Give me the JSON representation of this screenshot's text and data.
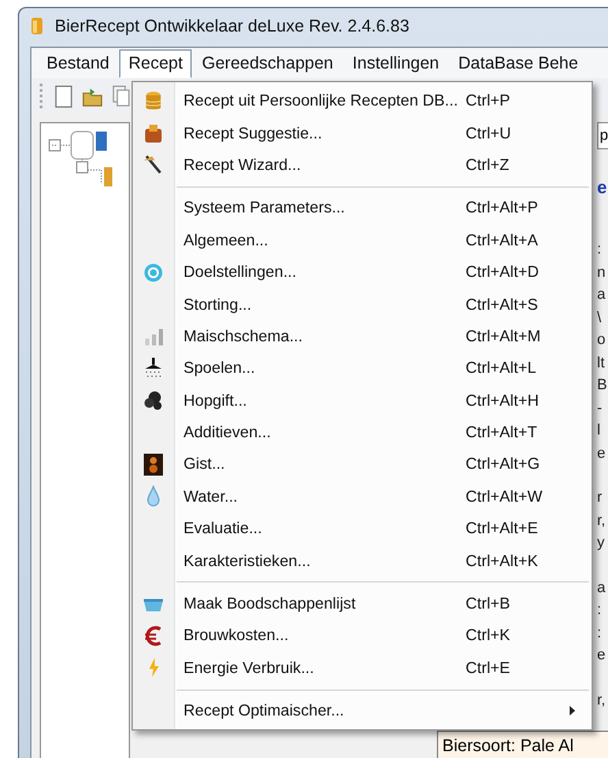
{
  "window": {
    "title": "BierRecept Ontwikkelaar deLuxe Rev. 2.4.6.83"
  },
  "menubar": [
    {
      "label": "Bestand",
      "selected": false
    },
    {
      "label": "Recept",
      "selected": true
    },
    {
      "label": "Gereedschappen",
      "selected": false
    },
    {
      "label": "Instellingen",
      "selected": false
    },
    {
      "label": "DataBase Behe",
      "selected": false
    }
  ],
  "menu": [
    {
      "kind": "item",
      "label": "Recept uit Persoonlijke Recepten DB...",
      "shortcut": "Ctrl+P"
    },
    {
      "kind": "item",
      "label": "Recept Suggestie...",
      "shortcut": "Ctrl+U"
    },
    {
      "kind": "item",
      "label": "Recept Wizard...",
      "shortcut": "Ctrl+Z"
    },
    {
      "kind": "separator"
    },
    {
      "kind": "item",
      "label": "Systeem Parameters...",
      "shortcut": "Ctrl+Alt+P"
    },
    {
      "kind": "item",
      "label": "Algemeen...",
      "shortcut": "Ctrl+Alt+A"
    },
    {
      "kind": "item",
      "label": "Doelstellingen...",
      "shortcut": "Ctrl+Alt+D"
    },
    {
      "kind": "item",
      "label": "Storting...",
      "shortcut": "Ctrl+Alt+S"
    },
    {
      "kind": "item",
      "label": "Maischschema...",
      "shortcut": "Ctrl+Alt+M"
    },
    {
      "kind": "item",
      "label": "Spoelen...",
      "shortcut": "Ctrl+Alt+L"
    },
    {
      "kind": "item",
      "label": "Hopgift...",
      "shortcut": "Ctrl+Alt+H"
    },
    {
      "kind": "item",
      "label": "Additieven...",
      "shortcut": "Ctrl+Alt+T"
    },
    {
      "kind": "item",
      "label": "Gist...",
      "shortcut": "Ctrl+Alt+G"
    },
    {
      "kind": "item",
      "label": "Water...",
      "shortcut": "Ctrl+Alt+W"
    },
    {
      "kind": "item",
      "label": "Evaluatie...",
      "shortcut": "Ctrl+Alt+E"
    },
    {
      "kind": "item",
      "label": "Karakteristieken...",
      "shortcut": "Ctrl+Alt+K"
    },
    {
      "kind": "separator"
    },
    {
      "kind": "item",
      "label": "Maak Boodschappenlijst",
      "shortcut": "Ctrl+B"
    },
    {
      "kind": "item",
      "label": "Brouwkosten...",
      "shortcut": "Ctrl+K"
    },
    {
      "kind": "item",
      "label": "Energie Verbruik...",
      "shortcut": "Ctrl+E"
    },
    {
      "kind": "separator"
    },
    {
      "kind": "submenu",
      "label": "Recept Optimaischer..."
    }
  ],
  "right_panel": {
    "field_text": "p",
    "heading": "e",
    "blocks": [
      [
        ":",
        "n",
        "a",
        "\\",
        "o",
        "lt",
        "B",
        "-",
        "l",
        "e"
      ],
      [
        "r",
        "r,",
        "y"
      ],
      [
        "a",
        ":",
        ":",
        "e"
      ],
      [
        "r,"
      ]
    ],
    "info_line": "Biersoort: Pale Al"
  }
}
